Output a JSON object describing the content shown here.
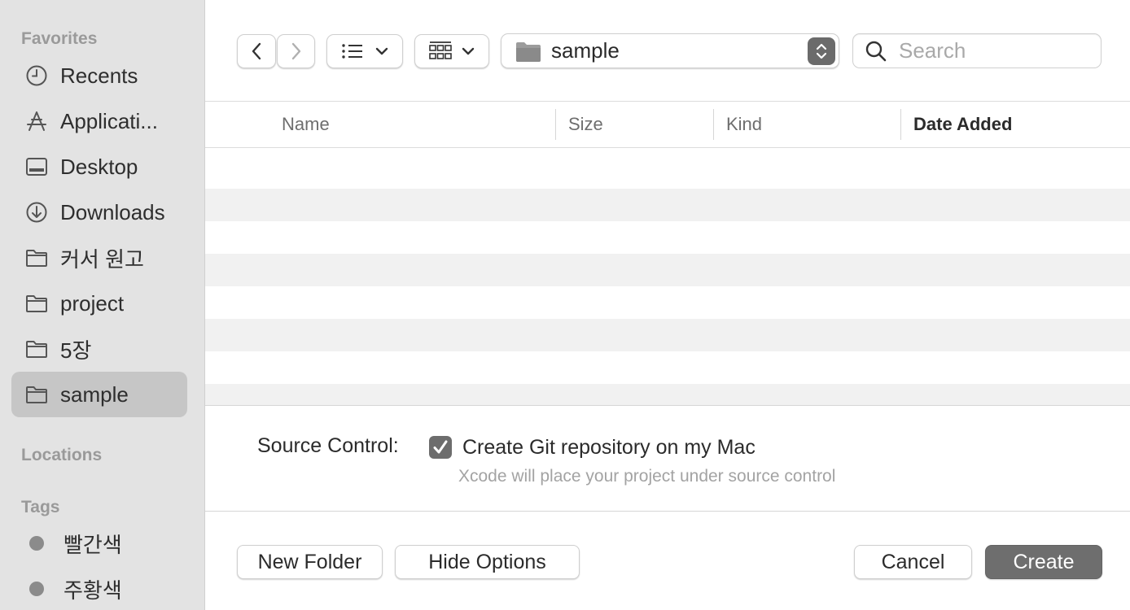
{
  "sidebar": {
    "favorites_header": "Favorites",
    "favorites": [
      {
        "label": "Recents",
        "icon": "clock-icon"
      },
      {
        "label": "Applicati...",
        "icon": "applications-icon"
      },
      {
        "label": "Desktop",
        "icon": "desktop-icon"
      },
      {
        "label": "Downloads",
        "icon": "download-icon"
      },
      {
        "label": "커서 원고",
        "icon": "folder-icon"
      },
      {
        "label": "project",
        "icon": "folder-icon"
      },
      {
        "label": "5장",
        "icon": "folder-icon"
      },
      {
        "label": "sample",
        "icon": "folder-icon",
        "selected": true
      }
    ],
    "locations_header": "Locations",
    "tags_header": "Tags",
    "tags": [
      {
        "label": "빨간색"
      },
      {
        "label": "주황색"
      }
    ]
  },
  "toolbar": {
    "path_label": "sample",
    "search_placeholder": "Search"
  },
  "file_list": {
    "columns": [
      "Name",
      "Size",
      "Kind",
      "Date Added"
    ],
    "sorted_column": "Date Added",
    "rows": []
  },
  "options": {
    "source_control_label": "Source Control:",
    "git_checkbox_label": "Create Git repository on my Mac",
    "git_checked": true,
    "hint": "Xcode will place your project under source control"
  },
  "buttons": {
    "new_folder": "New Folder",
    "hide_options": "Hide Options",
    "cancel": "Cancel",
    "create": "Create"
  },
  "colors": {
    "sidebar_bg": "#e3e3e3",
    "selected_bg": "#c6c6c6",
    "primary_button": "#6e6e6e",
    "alt_row": "#f1f1f1"
  }
}
